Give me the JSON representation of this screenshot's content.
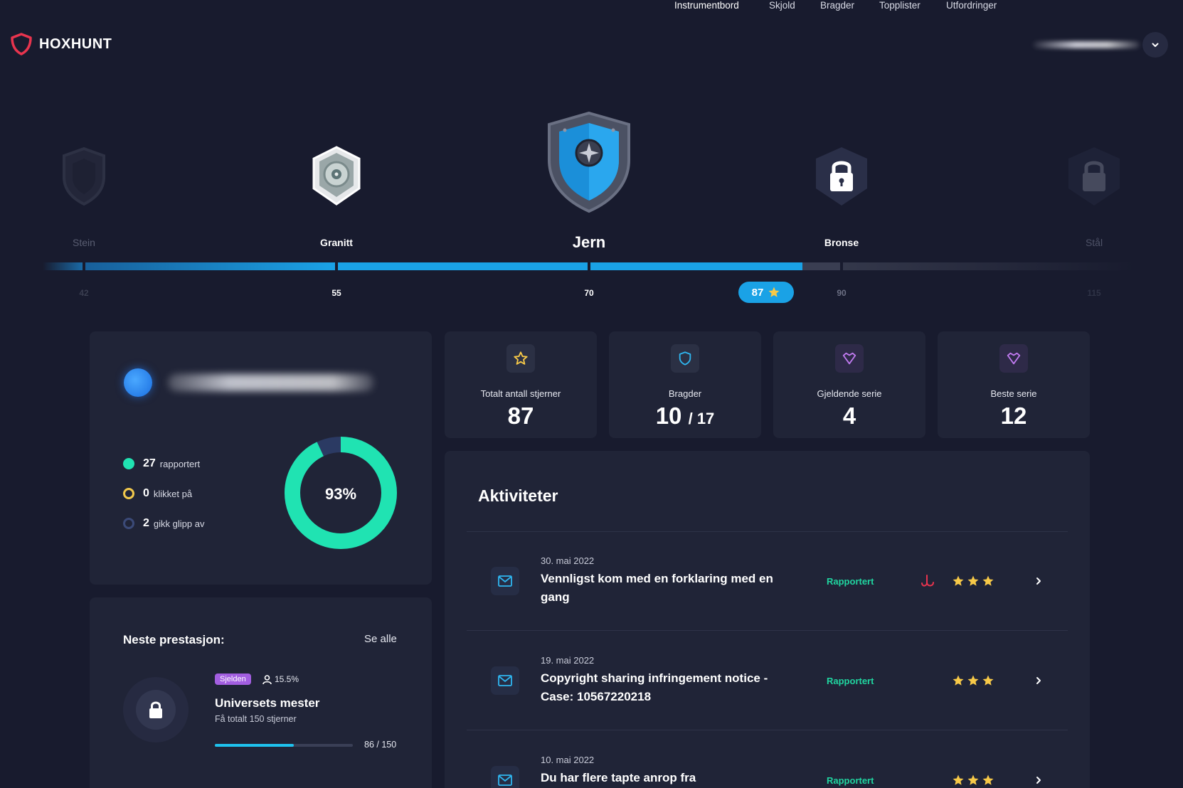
{
  "brand": {
    "name": "HOXHUNT",
    "accent": "#e8344e"
  },
  "nav": {
    "items": [
      "Instrumentbord",
      "Skjold",
      "Bragder",
      "Topplister",
      "Utfordringer"
    ],
    "active": "Instrumentbord"
  },
  "levels": [
    {
      "name": "Stein",
      "threshold": "42",
      "state": "passed"
    },
    {
      "name": "Granitt",
      "threshold": "55",
      "state": "passed"
    },
    {
      "name": "Jern",
      "threshold": "70",
      "state": "current"
    },
    {
      "name": "Bronse",
      "threshold": "90",
      "state": "locked"
    },
    {
      "name": "Stål",
      "threshold": "115",
      "state": "locked"
    }
  ],
  "progress": {
    "current_stars": "87",
    "accent": "#1aa2e6"
  },
  "profile": {
    "legend": [
      {
        "count": "27",
        "label": "rapportert",
        "color": "#20e3b2"
      },
      {
        "count": "0",
        "label": "klikket på",
        "color": "#f2c94c"
      },
      {
        "count": "2",
        "label": "gikk glipp av",
        "color": "#3b4a78"
      }
    ],
    "donut_percent": "93%",
    "donut_fraction": 0.93
  },
  "stats": [
    {
      "label": "Totalt antall stjerner",
      "value": "87",
      "suffix": "",
      "icon": "star-icon"
    },
    {
      "label": "Bragder",
      "value": "10",
      "suffix": "/ 17",
      "icon": "shield-icon"
    },
    {
      "label": "Gjeldende serie",
      "value": "4",
      "suffix": "",
      "icon": "heart-icon"
    },
    {
      "label": "Beste serie",
      "value": "12",
      "suffix": "",
      "icon": "heart-icon"
    }
  ],
  "next_achievement": {
    "heading": "Neste prestasjon:",
    "see_all": "Se alle",
    "rarity": "Sjelden",
    "percent": "15.5%",
    "title": "Universets mester",
    "description": "Få totalt 150 stjerner",
    "progress_text": "86 / 150",
    "progress_fraction": 0.573
  },
  "activities": {
    "heading": "Aktiviteter",
    "items": [
      {
        "date": "30. mai 2022",
        "title": "Vennligst kom med en forklaring med en gang",
        "status": "Rapportert",
        "stars": 3,
        "flag": true
      },
      {
        "date": "19. mai 2022",
        "title": "Copyright sharing infringement notice - Case: 10567220218",
        "status": "Rapportert",
        "stars": 3,
        "flag": false
      },
      {
        "date": "10. mai 2022",
        "title": "Du har flere tapte anrop fra",
        "status": "Rapportert",
        "stars": 3,
        "flag": false
      }
    ]
  }
}
